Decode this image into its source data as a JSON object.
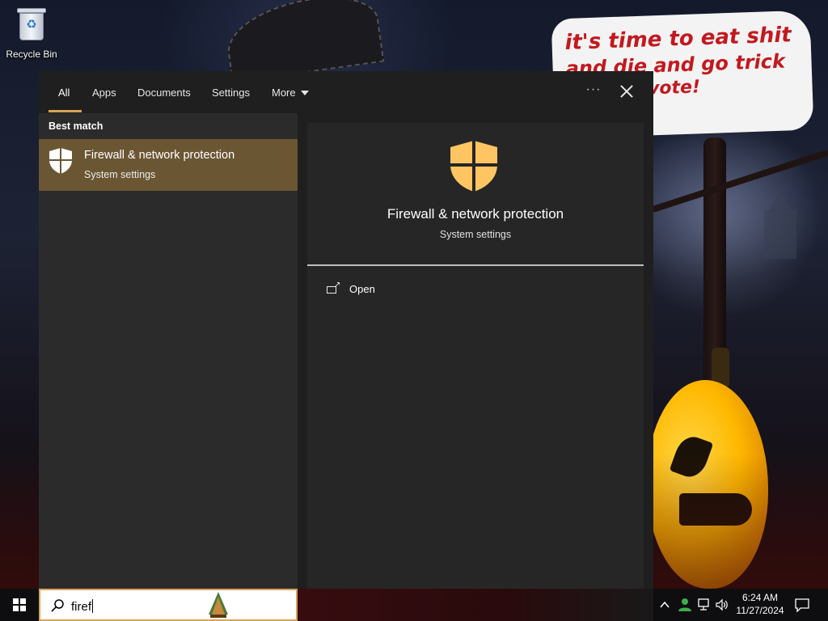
{
  "desktop": {
    "icons": [
      {
        "label": "Recycle Bin",
        "icon": "recycle-bin-icon"
      }
    ],
    "wallpaper_text": [
      "it's time to eat shit",
      "and die and go trick",
      "ing and vote!"
    ]
  },
  "search_panel": {
    "tabs": [
      {
        "label": "All",
        "active": true
      },
      {
        "label": "Apps"
      },
      {
        "label": "Documents"
      },
      {
        "label": "Settings"
      },
      {
        "label": "More"
      }
    ],
    "more_options_glyph": "···",
    "accent_color": "#d9a35a",
    "section_title": "Best match",
    "best_match": {
      "title": "Firewall & network protection",
      "subtitle": "System settings",
      "icon": "shield-icon"
    },
    "preview": {
      "title": "Firewall & network protection",
      "subtitle": "System settings",
      "icon": "shield-icon",
      "icon_color": "#ffc563",
      "actions": [
        {
          "label": "Open",
          "icon": "open-window-icon"
        }
      ]
    }
  },
  "taskbar": {
    "search": {
      "value": "firef",
      "icon": "search-icon"
    },
    "tray": {
      "icons": [
        "chevron-up-icon",
        "people-icon",
        "network-icon",
        "volume-icon"
      ],
      "time": "6:24 AM",
      "date": "11/27/2024",
      "notification_icon": "action-center-icon"
    }
  }
}
